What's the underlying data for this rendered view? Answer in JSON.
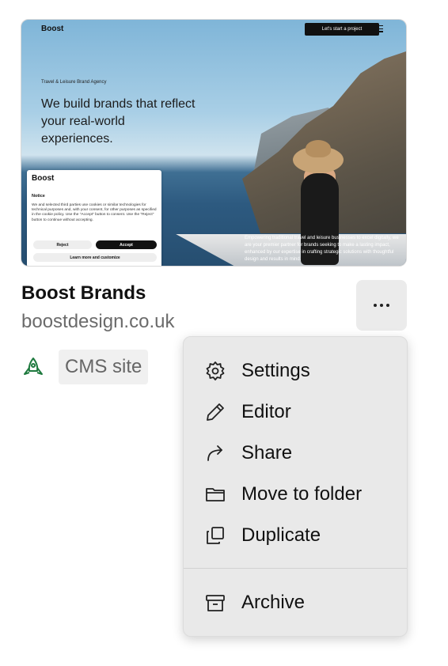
{
  "thumbnail": {
    "logo": "Boost",
    "cta": "Let's start a project",
    "tagline": "Travel & Leisure Brand Agency",
    "hero": "We build brands that reflect your real-world experiences.",
    "blurb": "Empowering traditional travel and leisure businesses to excel digitally, we are your premier partner for brands seeking to make a lasting impact, enhanced by our expertise in crafting strategic solutions with thoughtful design and results in mind.",
    "cookie": {
      "logo": "Boost",
      "notice": "Notice",
      "text": "We and selected third parties use cookies or similar technologies for technical purposes and, with your consent, for other purposes as specified in the cookie policy. Use the \"Accept\" button to consent. Use the \"Reject\" button to continue without accepting.",
      "reject": "Reject",
      "accept": "Accept",
      "learn_more": "Learn more and customize"
    }
  },
  "site": {
    "name": "Boost Brands",
    "domain": "boostdesign.co.uk",
    "badge": "CMS site",
    "badge_icon": "rocket-icon",
    "accent": "#1f7a3f"
  },
  "menu": {
    "items": [
      {
        "label": "Settings",
        "icon": "gear-icon"
      },
      {
        "label": "Editor",
        "icon": "pencil-icon"
      },
      {
        "label": "Share",
        "icon": "share-arrow-icon"
      },
      {
        "label": "Move to folder",
        "icon": "folder-icon"
      },
      {
        "label": "Duplicate",
        "icon": "duplicate-icon"
      },
      {
        "label": "Archive",
        "icon": "archive-icon"
      }
    ]
  }
}
